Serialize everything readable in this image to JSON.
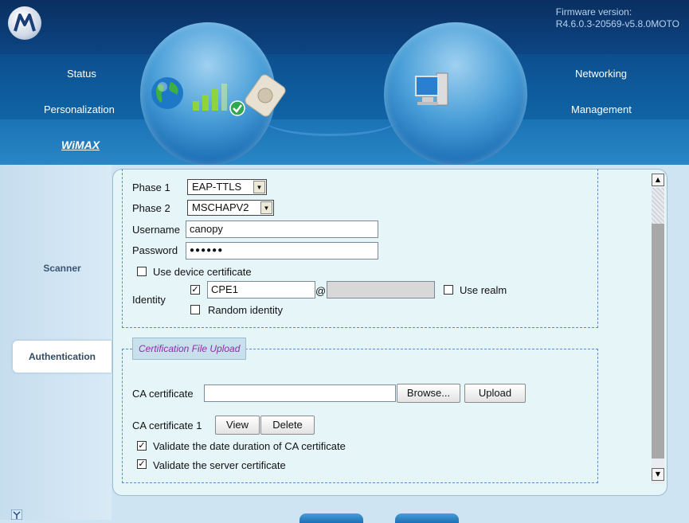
{
  "header": {
    "firmware_label": "Firmware version:",
    "firmware_value": "R4.6.0.3-20569-v5.8.0MOTO",
    "nav_left": [
      "Status",
      "Personalization",
      "WiMAX"
    ],
    "nav_right": [
      "Networking",
      "Management"
    ],
    "active_nav": "WiMAX"
  },
  "sidebar": {
    "items": [
      {
        "label": "Scanner",
        "active": false
      },
      {
        "label": "Authentication",
        "active": true
      }
    ]
  },
  "form": {
    "phase1_label": "Phase 1",
    "phase1_value": "EAP-TTLS",
    "phase2_label": "Phase 2",
    "phase2_value": "MSCHAPV2",
    "username_label": "Username",
    "username_value": "canopy",
    "password_label": "Password",
    "password_value": "●●●●●●",
    "use_device_cert_label": "Use device certificate",
    "use_device_cert_checked": false,
    "identity_label": "Identity",
    "identity_checked": true,
    "identity_value": "CPE1",
    "at_sign": "@",
    "realm_value": "",
    "use_realm_label": "Use realm",
    "use_realm_checked": false,
    "random_identity_label": "Random identity",
    "random_identity_checked": false
  },
  "upload": {
    "legend": "Certification File Upload",
    "ca_cert_label": "CA certificate",
    "ca_cert_value": "",
    "browse_label": "Browse...",
    "upload_label": "Upload",
    "ca_cert1_label": "CA certificate 1",
    "view_label": "View",
    "delete_label": "Delete",
    "validate_date_label": "Validate the date duration of CA certificate",
    "validate_date_checked": true,
    "validate_server_label": "Validate the server certificate",
    "validate_server_checked": true
  },
  "colors": {
    "header_blue": "#0d4d8c",
    "panel_bg": "#e6f5f8",
    "legend_text": "#8b2fa8"
  }
}
